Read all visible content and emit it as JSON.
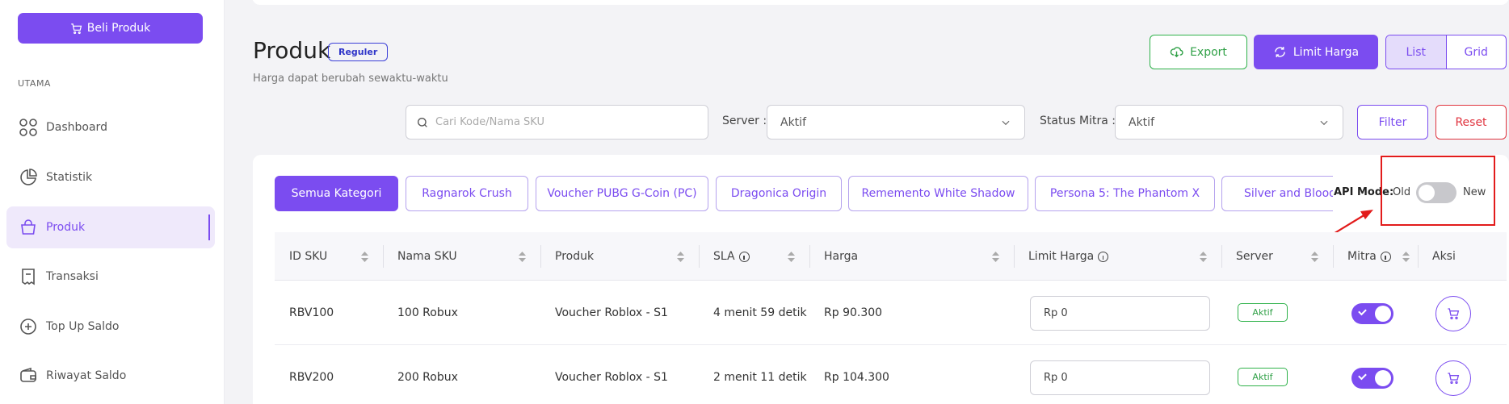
{
  "sidebar": {
    "buy_button": "Beli Produk",
    "section": "UTAMA",
    "items": [
      {
        "label": "Dashboard",
        "icon": "grid-icon"
      },
      {
        "label": "Statistik",
        "icon": "pie-chart-icon"
      },
      {
        "label": "Produk",
        "icon": "shopping-bag-icon",
        "active": true
      },
      {
        "label": "Transaksi",
        "icon": "receipt-icon"
      },
      {
        "label": "Top Up Saldo",
        "icon": "plus-circle-icon"
      },
      {
        "label": "Riwayat Saldo",
        "icon": "wallet-icon"
      }
    ]
  },
  "header": {
    "title": "Produk",
    "badge": "Reguler",
    "subtitle": "Harga dapat berubah sewaktu-waktu",
    "export_label": "Export",
    "limit_label": "Limit Harga",
    "view_list": "List",
    "view_grid": "Grid"
  },
  "filters": {
    "search_placeholder": "Cari Kode/Nama SKU",
    "server_label": "Server :",
    "server_value": "Aktif",
    "mitra_label": "Status Mitra :",
    "mitra_value": "Aktif",
    "filter_label": "Filter",
    "reset_label": "Reset"
  },
  "categories": [
    "Semua Kategori",
    "Ragnarok Crush",
    "Voucher PUBG G-Coin (PC)",
    "Dragonica Origin",
    "Rememento White Shadow",
    "Persona 5: The Phantom X",
    "Silver and Blood"
  ],
  "api_mode": {
    "label": "API Mode:",
    "old": "Old",
    "new": "New",
    "enabled": false
  },
  "table": {
    "headers": [
      "ID SKU",
      "Nama SKU",
      "Produk",
      "SLA",
      "Harga",
      "Limit Harga",
      "Server",
      "Mitra",
      "Aksi"
    ],
    "rows": [
      {
        "id": "RBV100",
        "name": "100 Robux",
        "product": "Voucher Roblox - S1",
        "sla": "4 menit 59 detik",
        "price": "Rp 90.300",
        "limit": "Rp 0",
        "server": "Aktif",
        "mitra": true
      },
      {
        "id": "RBV200",
        "name": "200 Robux",
        "product": "Voucher Roblox - S1",
        "sla": "2 menit 11 detik",
        "price": "Rp 104.300",
        "limit": "Rp 0",
        "server": "Aktif",
        "mitra": true
      }
    ]
  },
  "colors": {
    "accent": "#7b4cf0",
    "success": "#2fb24a",
    "danger": "#e0343f",
    "highlight": "#e21b1b"
  }
}
